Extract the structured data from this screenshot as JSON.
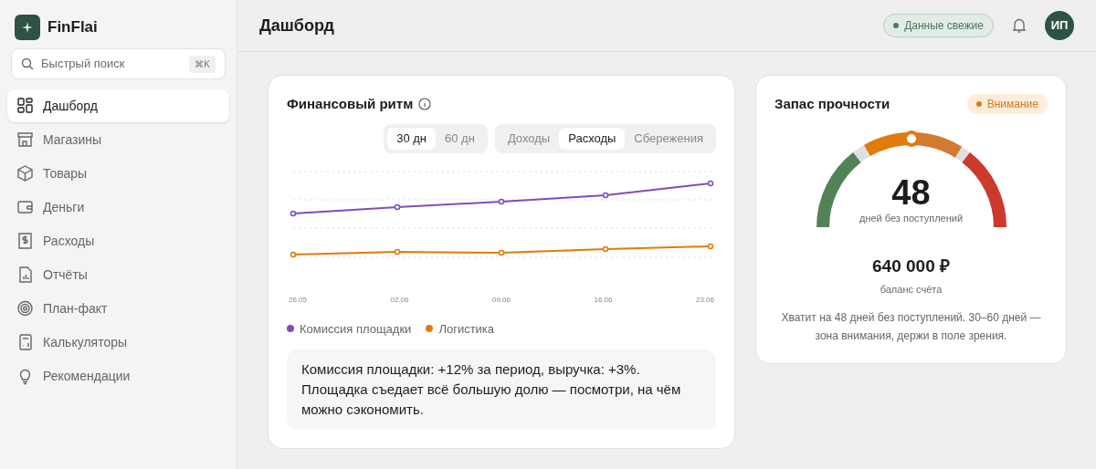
{
  "app": {
    "name": "FinFlai"
  },
  "search": {
    "placeholder": "Быстрый поиск",
    "shortcut": "⌘K"
  },
  "sidebar": {
    "items": [
      {
        "label": "Дашборд",
        "selected": true
      },
      {
        "label": "Магазины",
        "selected": false
      },
      {
        "label": "Товары",
        "selected": false
      },
      {
        "label": "Деньги",
        "selected": false
      },
      {
        "label": "Расходы",
        "selected": false
      },
      {
        "label": "Отчёты",
        "selected": false
      },
      {
        "label": "План-факт",
        "selected": false
      },
      {
        "label": "Калькуляторы",
        "selected": false
      },
      {
        "label": "Рекомендации",
        "selected": false
      }
    ]
  },
  "header": {
    "title": "Дашборд",
    "status": "Данные свежие",
    "avatar": "ИП"
  },
  "rhythm": {
    "title": "Финансовый ритм",
    "periods": [
      {
        "label": "30 дн",
        "selected": true
      },
      {
        "label": "60 дн",
        "selected": false
      }
    ],
    "modes": [
      {
        "label": "Доходы",
        "selected": false
      },
      {
        "label": "Расходы",
        "selected": true
      },
      {
        "label": "Сбережения",
        "selected": false
      }
    ],
    "dates": [
      "26.05",
      "02.06",
      "09.06",
      "16.06",
      "23.06"
    ],
    "legend": [
      {
        "label": "Комиссия площадки",
        "color": "#7c4dbe"
      },
      {
        "label": "Логистика",
        "color": "#e07b0c"
      }
    ],
    "note": "Комиссия площадки: +12% за период, выручка: +3%. Площадка съедает всё большую долю — посмотри, на чём можно сэкономить."
  },
  "reserve": {
    "title": "Запас прочности",
    "badge": "Внимание",
    "days": "48",
    "days_caption": "дней без поступлений",
    "balance": "640 000 ₽",
    "balance_caption": "баланс счёта",
    "note": "Хватит на 48 дней без поступлений. 30–60 дней — зона внимания, держи в поле зрения."
  }
}
